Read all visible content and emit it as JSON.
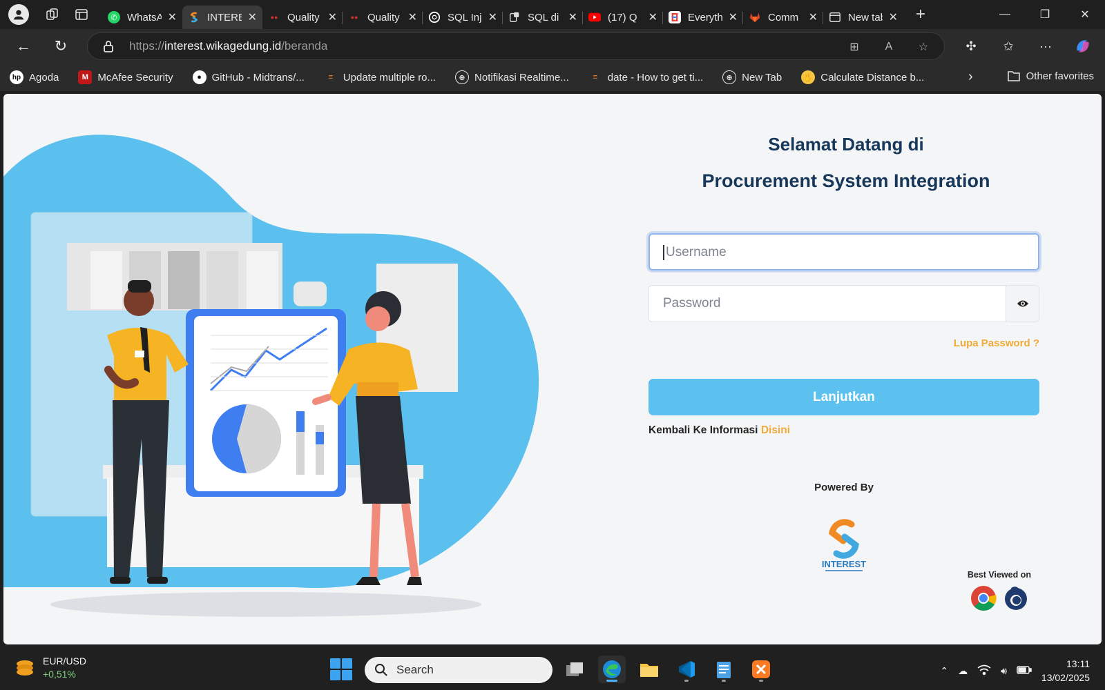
{
  "browser": {
    "tabs": [
      {
        "title": "WhatsApp",
        "icon": "whatsapp-icon",
        "color": "#25D366",
        "active": false
      },
      {
        "title": "INTEREST",
        "icon": "interest-logo-icon",
        "color": "#f08a24",
        "active": true
      },
      {
        "title": "Quality",
        "icon": "quality-app-icon",
        "color": "#d32f2f",
        "active": false
      },
      {
        "title": "Quality",
        "icon": "quality-app-icon",
        "color": "#d32f2f",
        "active": false
      },
      {
        "title": "SQL Injection",
        "icon": "openai-icon",
        "color": "#ffffff",
        "active": false
      },
      {
        "title": "SQL di",
        "icon": "db-icon",
        "color": "#cfcfcf",
        "active": false
      },
      {
        "title": "(17) Q",
        "icon": "youtube-icon",
        "color": "#ff0000",
        "active": false
      },
      {
        "title": "Everything",
        "icon": "google-icon",
        "color": "#ffffff",
        "active": false
      },
      {
        "title": "Comm",
        "icon": "gitlab-icon",
        "color": "#e24329",
        "active": false
      },
      {
        "title": "New tab",
        "icon": "newtab-icon",
        "color": "#cfcfcf",
        "active": false
      }
    ],
    "url_prefix": "https://",
    "url_host": "interest.wikagedung.id",
    "url_path": "/beranda",
    "bookmarks": [
      {
        "label": "Agoda",
        "icon": "hp-icon",
        "color": "#ffffff"
      },
      {
        "label": "McAfee Security",
        "icon": "mcafee-icon",
        "color": "#c01818"
      },
      {
        "label": "GitHub - Midtrans/...",
        "icon": "github-icon",
        "color": "#ffffff"
      },
      {
        "label": "Update multiple ro...",
        "icon": "stackoverflow-icon",
        "color": "#f48024"
      },
      {
        "label": "Notifikasi Realtime...",
        "icon": "globe-icon",
        "color": "#e6e6e6"
      },
      {
        "label": "date - How to get ti...",
        "icon": "stackoverflow-icon",
        "color": "#f48024"
      },
      {
        "label": "New Tab",
        "icon": "globe-icon",
        "color": "#e6e6e6"
      },
      {
        "label": "Calculate Distance b...",
        "icon": "wave-hand-icon",
        "color": "#f5c542"
      }
    ],
    "other_favorites": "Other favorites"
  },
  "page": {
    "welcome_line1": "Selamat Datang di",
    "welcome_line2": "Procurement System Integration",
    "username_placeholder": "Username",
    "password_placeholder": "Password",
    "forgot_password": "Lupa Password ?",
    "submit_label": "Lanjutkan",
    "back_text": "Kembali Ke Informasi",
    "back_link": "Disini",
    "powered_by": "Powered By",
    "logo_text": "INTEREST",
    "best_viewed": "Best Viewed on",
    "colors": {
      "primary": "#5cc1ee",
      "accent": "#f0aa36",
      "heading": "#17385a"
    }
  },
  "taskbar": {
    "ticker_label": "EUR/USD",
    "ticker_change": "+0,51%",
    "search_placeholder": "Search",
    "time": "13:11",
    "date": "13/02/2025"
  }
}
